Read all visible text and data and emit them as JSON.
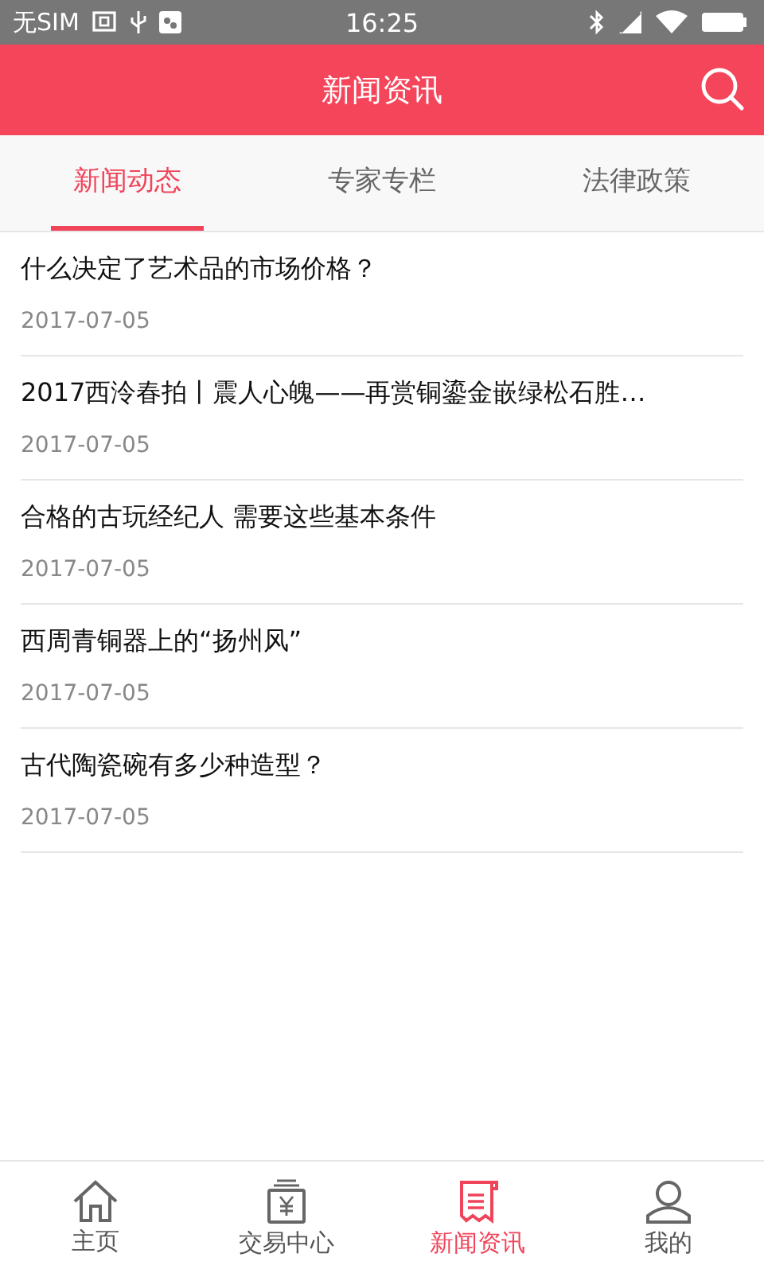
{
  "status_bar": {
    "carrier": "无SIM",
    "time": "16:25"
  },
  "header": {
    "title": "新闻资讯"
  },
  "tabs": [
    {
      "label": "新闻动态",
      "selected": true
    },
    {
      "label": "专家专栏",
      "selected": false
    },
    {
      "label": "法律政策",
      "selected": false
    }
  ],
  "news": [
    {
      "title": "什么决定了艺术品的市场价格？",
      "date": "2017-07-05"
    },
    {
      "title": "2017西泠春拍丨震人心魄——再赏铜鎏金嵌绿松石胜…",
      "date": "2017-07-05"
    },
    {
      "title": "合格的古玩经纪人 需要这些基本条件",
      "date": "2017-07-05"
    },
    {
      "title": "西周青铜器上的“扬州风”",
      "date": "2017-07-05"
    },
    {
      "title": "古代陶瓷碗有多少种造型？",
      "date": "2017-07-05"
    }
  ],
  "bottom_nav": [
    {
      "label": "主页",
      "kind": "home",
      "selected": false
    },
    {
      "label": "交易中心",
      "kind": "trade",
      "selected": false
    },
    {
      "label": "新闻资讯",
      "kind": "news",
      "selected": true
    },
    {
      "label": "我的",
      "kind": "profile",
      "selected": false
    }
  ]
}
